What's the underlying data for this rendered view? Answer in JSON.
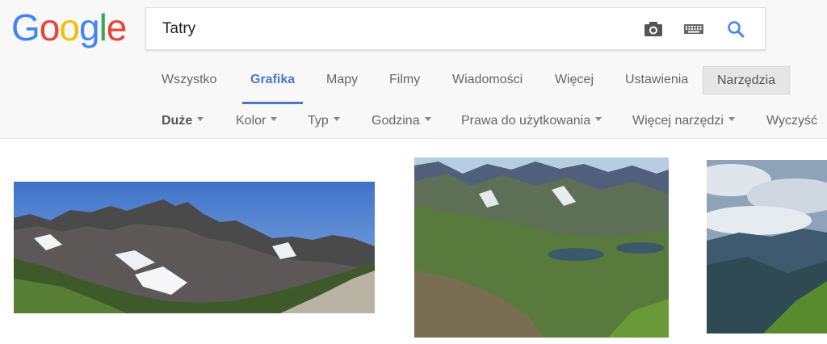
{
  "logo": {
    "letters": [
      "G",
      "o",
      "o",
      "g",
      "l",
      "e"
    ],
    "colors": [
      "#4285F4",
      "#EA4335",
      "#FBBC05",
      "#4285F4",
      "#34A853",
      "#EA4335"
    ]
  },
  "search": {
    "query": "Tatry",
    "icons": [
      "camera-icon",
      "keyboard-icon",
      "search-icon"
    ]
  },
  "nav": {
    "tabs": [
      {
        "label": "Wszystko"
      },
      {
        "label": "Grafika",
        "active": true
      },
      {
        "label": "Mapy"
      },
      {
        "label": "Filmy"
      },
      {
        "label": "Wiadomości"
      },
      {
        "label": "Więcej"
      },
      {
        "label": "Ustawienia"
      }
    ],
    "tools_label": "Narzędzia"
  },
  "filters": [
    {
      "label": "Duże",
      "bold": true
    },
    {
      "label": "Kolor"
    },
    {
      "label": "Typ"
    },
    {
      "label": "Godzina"
    },
    {
      "label": "Prawa do użytkowania"
    },
    {
      "label": "Więcej narzędzi"
    },
    {
      "label": "Wyczyść",
      "no_caret": true
    }
  ],
  "colors": {
    "accent": "#4a79c9",
    "tools_bg": "#e6e6e6"
  },
  "results": [
    {
      "name": "image-result-tatry-panorama"
    },
    {
      "name": "image-result-tatry-valley-lakes"
    },
    {
      "name": "image-result-tatry-clouds"
    }
  ]
}
